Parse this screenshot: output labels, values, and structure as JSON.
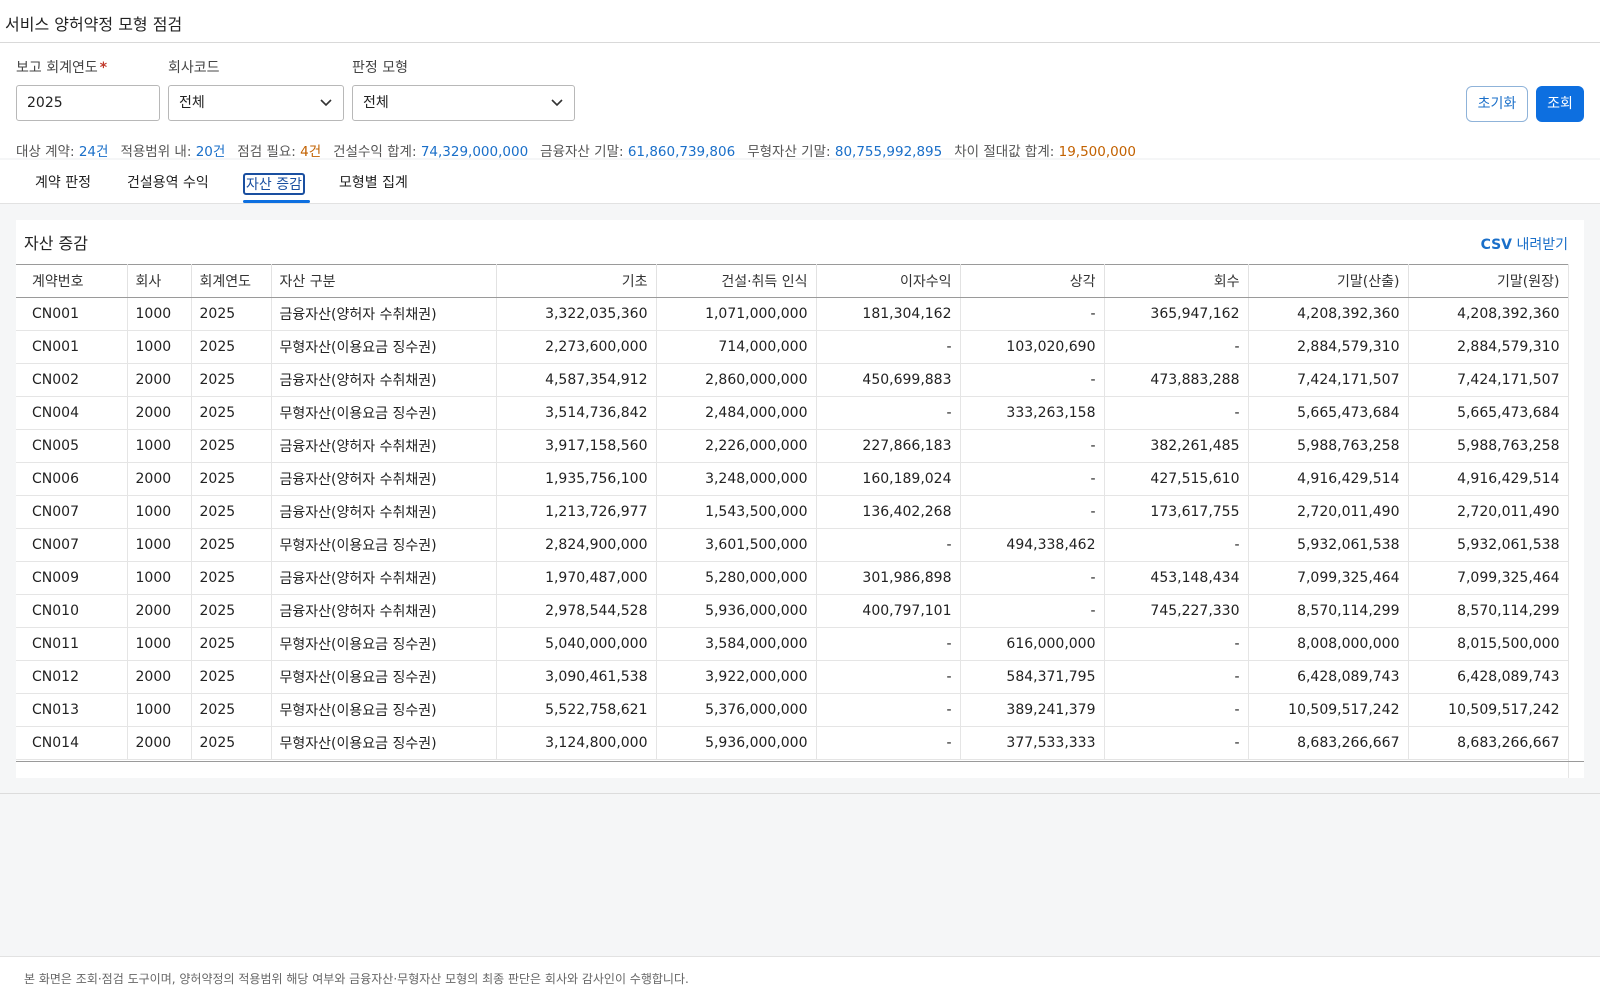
{
  "page": {
    "title": "서비스 양허약정 모형 점검"
  },
  "filters": {
    "year_label": "보고 회계연도",
    "year_required_mark": "*",
    "year_value": "2025",
    "company_label": "회사코드",
    "company_value": "전체",
    "model_label": "판정 모형",
    "model_value": "전체",
    "reset_label": "초기화",
    "search_label": "조회"
  },
  "summary": [
    {
      "label": "대상 계약:",
      "value": "24건",
      "tone": "blue"
    },
    {
      "label": "적용범위 내:",
      "value": "20건",
      "tone": "blue"
    },
    {
      "label": "점검 필요:",
      "value": "4건",
      "tone": "orange"
    },
    {
      "label": "건설수익 합계:",
      "value": "74,329,000,000",
      "tone": "blue"
    },
    {
      "label": "금융자산 기말:",
      "value": "61,860,739,806",
      "tone": "blue"
    },
    {
      "label": "무형자산 기말:",
      "value": "80,755,992,895",
      "tone": "blue"
    },
    {
      "label": "차이 절대값 합계:",
      "value": "19,500,000",
      "tone": "orange"
    }
  ],
  "tabs": [
    "계약 판정",
    "건설용역 수익",
    "자산 증감",
    "모형별 집계"
  ],
  "active_tab": "자산 증감",
  "panel": {
    "title": "자산 증감",
    "csv_bold": "CSV",
    "csv_rest": " 내려받기"
  },
  "table": {
    "columns": [
      "계약번호",
      "회사",
      "회계연도",
      "자산 구분",
      "기초",
      "건설·취득 인식",
      "이자수익",
      "상각",
      "회수",
      "기말(산출)",
      "기말(원장)"
    ],
    "rows": [
      [
        "CN001",
        "1000",
        "2025",
        "금융자산(양허자 수취채권)",
        "3,322,035,360",
        "1,071,000,000",
        "181,304,162",
        "-",
        "365,947,162",
        "4,208,392,360",
        "4,208,392,360"
      ],
      [
        "CN001",
        "1000",
        "2025",
        "무형자산(이용요금 징수권)",
        "2,273,600,000",
        "714,000,000",
        "-",
        "103,020,690",
        "-",
        "2,884,579,310",
        "2,884,579,310"
      ],
      [
        "CN002",
        "2000",
        "2025",
        "금융자산(양허자 수취채권)",
        "4,587,354,912",
        "2,860,000,000",
        "450,699,883",
        "-",
        "473,883,288",
        "7,424,171,507",
        "7,424,171,507"
      ],
      [
        "CN004",
        "2000",
        "2025",
        "무형자산(이용요금 징수권)",
        "3,514,736,842",
        "2,484,000,000",
        "-",
        "333,263,158",
        "-",
        "5,665,473,684",
        "5,665,473,684"
      ],
      [
        "CN005",
        "1000",
        "2025",
        "금융자산(양허자 수취채권)",
        "3,917,158,560",
        "2,226,000,000",
        "227,866,183",
        "-",
        "382,261,485",
        "5,988,763,258",
        "5,988,763,258"
      ],
      [
        "CN006",
        "2000",
        "2025",
        "금융자산(양허자 수취채권)",
        "1,935,756,100",
        "3,248,000,000",
        "160,189,024",
        "-",
        "427,515,610",
        "4,916,429,514",
        "4,916,429,514"
      ],
      [
        "CN007",
        "1000",
        "2025",
        "금융자산(양허자 수취채권)",
        "1,213,726,977",
        "1,543,500,000",
        "136,402,268",
        "-",
        "173,617,755",
        "2,720,011,490",
        "2,720,011,490"
      ],
      [
        "CN007",
        "1000",
        "2025",
        "무형자산(이용요금 징수권)",
        "2,824,900,000",
        "3,601,500,000",
        "-",
        "494,338,462",
        "-",
        "5,932,061,538",
        "5,932,061,538"
      ],
      [
        "CN009",
        "1000",
        "2025",
        "금융자산(양허자 수취채권)",
        "1,970,487,000",
        "5,280,000,000",
        "301,986,898",
        "-",
        "453,148,434",
        "7,099,325,464",
        "7,099,325,464"
      ],
      [
        "CN010",
        "2000",
        "2025",
        "금융자산(양허자 수취채권)",
        "2,978,544,528",
        "5,936,000,000",
        "400,797,101",
        "-",
        "745,227,330",
        "8,570,114,299",
        "8,570,114,299"
      ],
      [
        "CN011",
        "1000",
        "2025",
        "무형자산(이용요금 징수권)",
        "5,040,000,000",
        "3,584,000,000",
        "-",
        "616,000,000",
        "-",
        "8,008,000,000",
        "8,015,500,000"
      ],
      [
        "CN012",
        "2000",
        "2025",
        "무형자산(이용요금 징수권)",
        "3,090,461,538",
        "3,922,000,000",
        "-",
        "584,371,795",
        "-",
        "6,428,089,743",
        "6,428,089,743"
      ],
      [
        "CN013",
        "1000",
        "2025",
        "무형자산(이용요금 징수권)",
        "5,522,758,621",
        "5,376,000,000",
        "-",
        "389,241,379",
        "-",
        "10,509,517,242",
        "10,509,517,242"
      ],
      [
        "CN014",
        "2000",
        "2025",
        "무형자산(이용요금 징수권)",
        "3,124,800,000",
        "5,936,000,000",
        "-",
        "377,533,333",
        "-",
        "8,683,266,667",
        "8,683,266,667"
      ]
    ]
  },
  "footer": {
    "note": "본 화면은 조회·점검 도구이며, 양허약정의 적용범위 해당 여부와 금융자산·무형자산 모형의 최종 판단은 회사와 감사인이 수행합니다."
  }
}
